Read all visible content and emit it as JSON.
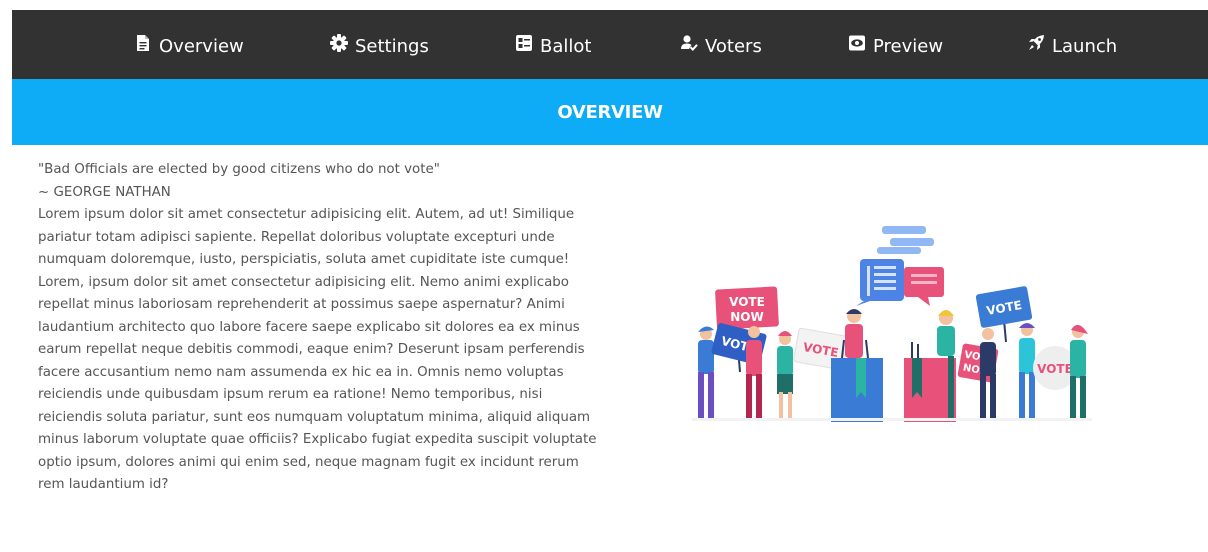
{
  "nav": {
    "items": [
      {
        "id": "overview",
        "label": "Overview",
        "icon": "document-icon"
      },
      {
        "id": "settings",
        "label": "Settings",
        "icon": "gear-icon"
      },
      {
        "id": "ballot",
        "label": "Ballot",
        "icon": "ballot-list-icon"
      },
      {
        "id": "voters",
        "label": "Voters",
        "icon": "user-check-icon"
      },
      {
        "id": "preview",
        "label": "Preview",
        "icon": "eye-icon"
      },
      {
        "id": "launch",
        "label": "Launch",
        "icon": "rocket-icon"
      }
    ]
  },
  "banner": {
    "title": "OVERVIEW"
  },
  "overview": {
    "quote": "\"Bad Officials are elected by good citizens who do not vote\"",
    "author": "~ GEORGE NATHAN",
    "body": "Lorem ipsum dolor sit amet consectetur adipisicing elit. Autem, ad ut! Similique pariatur totam adipisci sapiente. Repellat doloribus voluptate excepturi unde numquam doloremque, iusto, perspiciatis, soluta amet cupiditate iste cumque! Lorem, ipsum dolor sit amet consectetur adipisicing elit. Nemo animi explicabo repellat minus laboriosam reprehenderit at possimus saepe aspernatur? Animi laudantium architecto quo labore facere saepe explicabo sit dolores ea ex minus earum repellat neque debitis commodi, eaque enim? Deserunt ipsam perferendis facere accusantium nemo nam assumenda ex hic ea in. Omnis nemo voluptas reiciendis unde quibusdam ipsum rerum ea ratione! Nemo temporibus, nisi reiciendis soluta pariatur, sunt eos numquam voluptatum minima, aliquid aliquam minus laborum voluptate quae officiis? Explicabo fugiat expedita suscipit voluptate optio ipsum, dolores animi qui enim sed, neque magnam fugit ex incidunt rerum rem laudantium id?"
  },
  "illustration": {
    "signs": {
      "vote_now_1": "VOTE",
      "vote_now_2": "NOW",
      "vote_blue_left": "VOTE",
      "vote_white": "VOTE",
      "vote_now_right_1": "VOTE",
      "vote_now_right_2": "NOW",
      "vote_blue_right": "VOTE",
      "vote_circle": "VOTE"
    },
    "colors": {
      "blue": "#3a7bd5",
      "pink": "#e8527a",
      "teal": "#2bb3a3",
      "navy": "#2b3a67",
      "light_blue": "#8fb8f5"
    }
  },
  "colors": {
    "navbar": "#323232",
    "banner": "#0eabf7",
    "text": "#555555"
  }
}
